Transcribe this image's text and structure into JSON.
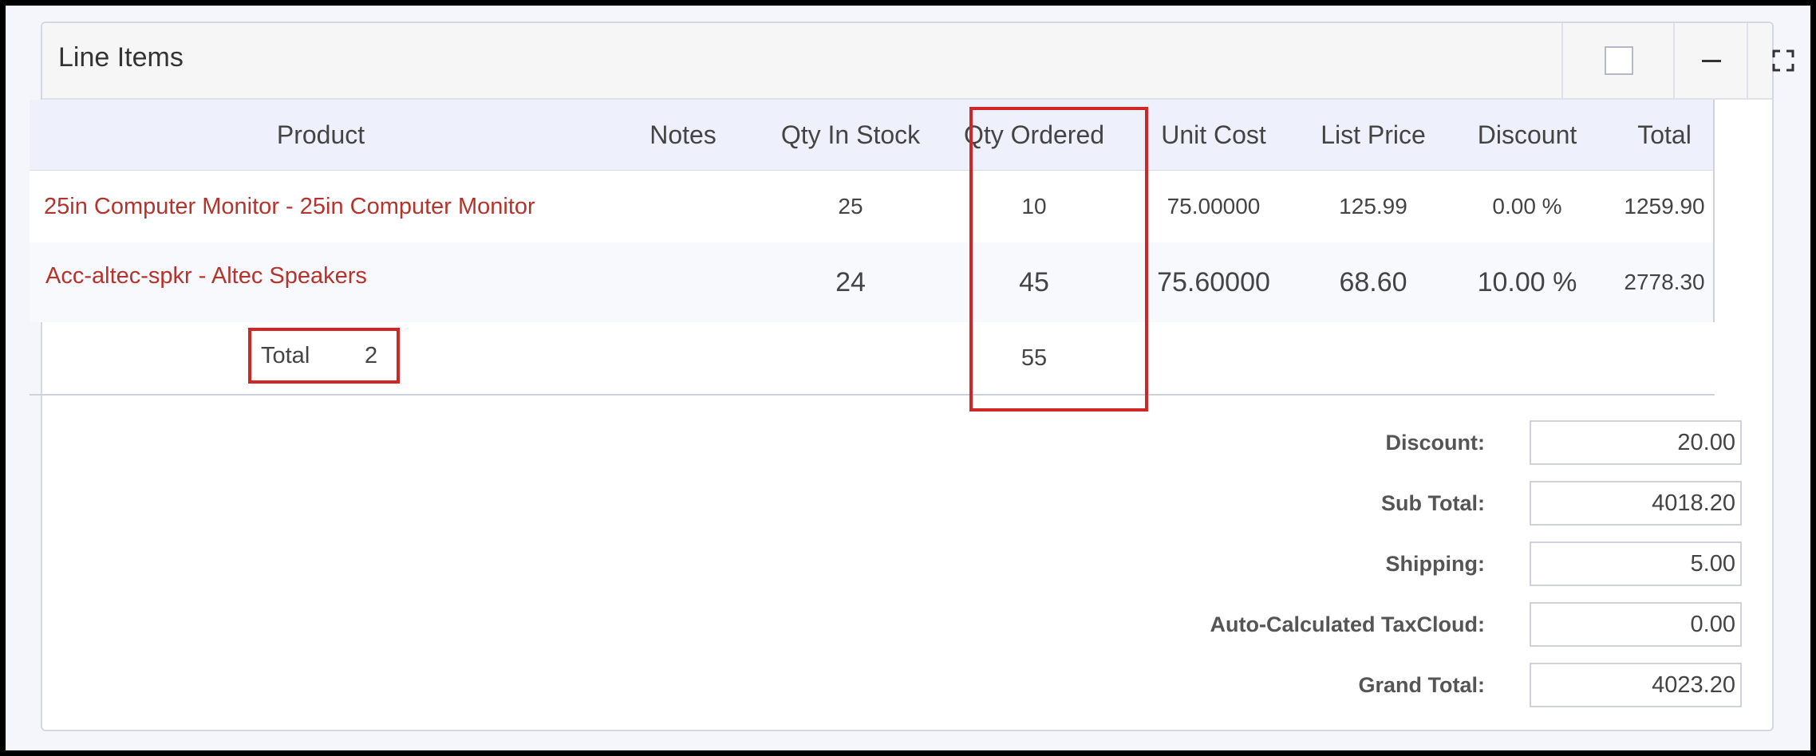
{
  "panel": {
    "title": "Line Items"
  },
  "columns": [
    "Product",
    "Notes",
    "Qty In Stock",
    "Qty Ordered",
    "Unit Cost",
    "List Price",
    "Discount",
    "Total"
  ],
  "rows": [
    {
      "product": "25in Computer Monitor - 25in Computer Monitor",
      "notes": "",
      "qty_in_stock": "25",
      "qty_ordered": "10",
      "unit_cost": "75.00000",
      "list_price": "125.99",
      "discount": "0.00 %",
      "total": "1259.90"
    },
    {
      "product": "Acc-altec-spkr - Altec Speakers",
      "notes": "",
      "qty_in_stock": "24",
      "qty_ordered": "45",
      "unit_cost": "75.60000",
      "list_price": "68.60",
      "discount": "10.00 %",
      "total": "2778.30"
    }
  ],
  "totals_row": {
    "label": "Total",
    "count": "2",
    "qty_ordered": "55"
  },
  "summary": {
    "discount": {
      "label": "Discount:",
      "value": "20.00"
    },
    "subtotal": {
      "label": "Sub Total:",
      "value": "4018.20"
    },
    "shipping": {
      "label": "Shipping:",
      "value": "5.00"
    },
    "tax": {
      "label": "Auto-Calculated TaxCloud:",
      "value": "0.00"
    },
    "grand_total": {
      "label": "Grand Total:",
      "value": "4023.20"
    }
  },
  "icons": {
    "checkbox": "checkbox-icon",
    "minimize": "minus-icon",
    "maximize": "expand-icon"
  },
  "colors": {
    "link": "#b5332c",
    "highlight": "#d02626",
    "header_bg": "#eef0fb"
  }
}
